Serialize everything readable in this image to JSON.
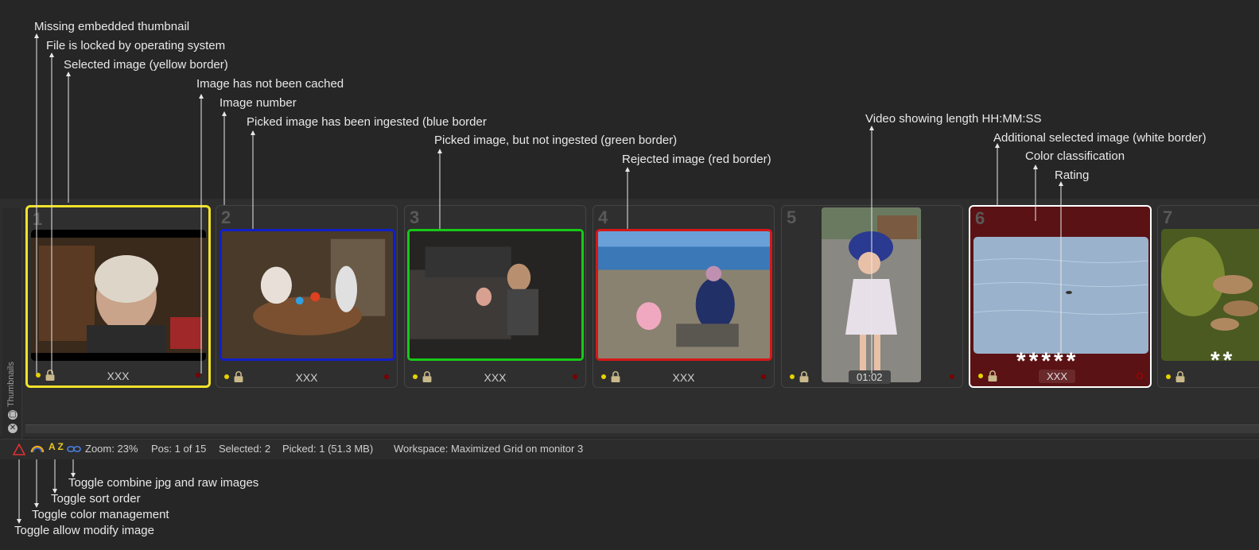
{
  "annotations": {
    "missing_thumb": "Missing embedded thumbnail",
    "file_locked": "File is locked by operating system",
    "selected_yellow": "Selected image (yellow border)",
    "not_cached": "Image has not been cached",
    "image_number": "Image number",
    "picked_ingested": "Picked image has been ingested (blue border",
    "picked_not_ingested": "Picked image, but not ingested (green border)",
    "rejected": "Rejected image (red border)",
    "video_length": "Video showing length HH:MM:SS",
    "additional_selected": "Additional selected image (white border)",
    "color_class": "Color classification",
    "rating": "Rating",
    "toggle_combine": "Toggle combine jpg and raw images",
    "toggle_sort": "Toggle sort order",
    "toggle_color": "Toggle color management",
    "toggle_modify": "Toggle allow modify image"
  },
  "sidebar": {
    "label": "Thumbnails"
  },
  "thumbnails": [
    {
      "number": "1",
      "caption": "XXX",
      "state": "selected"
    },
    {
      "number": "2",
      "caption": "XXX",
      "state": "picked-ingested"
    },
    {
      "number": "3",
      "caption": "XXX",
      "state": "picked-not-ingested"
    },
    {
      "number": "4",
      "caption": "XXX",
      "state": "rejected"
    },
    {
      "number": "5",
      "caption": "01:02",
      "state": "video"
    },
    {
      "number": "6",
      "caption": "XXX",
      "state": "additional-selected",
      "rating_text": "*****",
      "color_class": "#5a1214"
    },
    {
      "number": "7",
      "caption": "",
      "state": "normal",
      "rating_text": "**"
    }
  ],
  "status": {
    "zoom": "Zoom: 23%",
    "pos": "Pos: 1 of 15",
    "selected": "Selected: 2",
    "picked": "Picked: 1 (51.3 MB)",
    "workspace": "Workspace: Maximized Grid on monitor 3",
    "sort_icon_text": "A Z"
  },
  "colors": {
    "selected_border": "#f2e22a",
    "ingested_border": "#1020c8",
    "not_ingested_border": "#18c818",
    "rejected_border": "#d41818",
    "additional_border": "#ffffff"
  }
}
